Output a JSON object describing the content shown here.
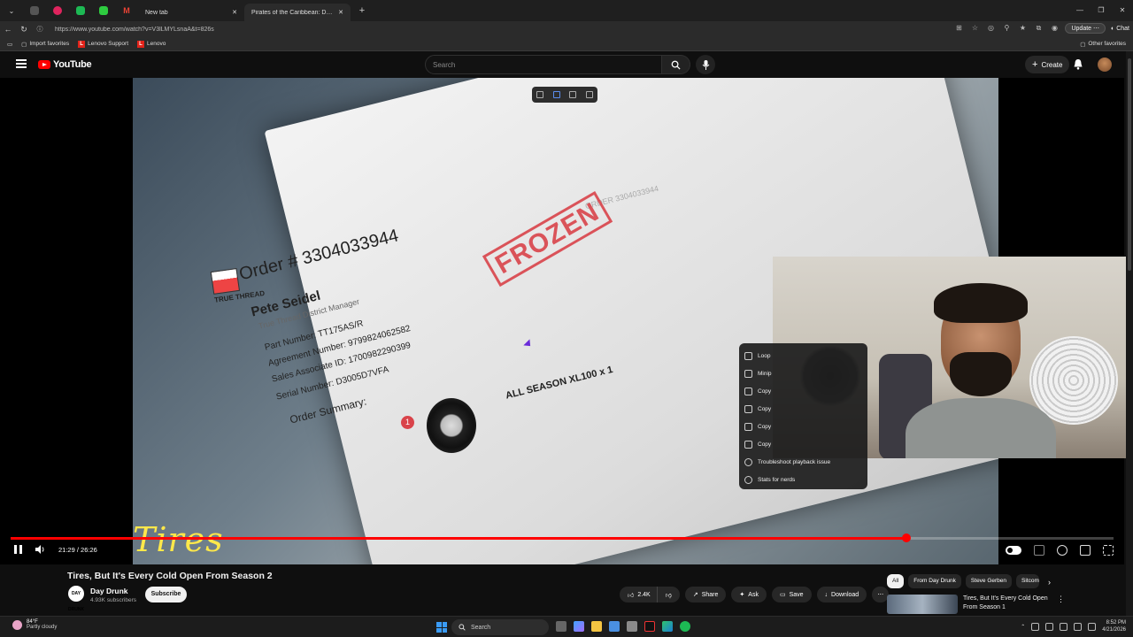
{
  "browser": {
    "tabs": [
      {
        "title": "New tab"
      },
      {
        "title": "Pirates of the Caribbean: Dead Ma"
      }
    ],
    "url": "https://www.youtube.com/watch?v=V3lLMYLsnaA&t=826s",
    "update_label": "Update",
    "chat_label": "Chat",
    "favorites": [
      "Import favorites",
      "Lenovo Support",
      "Lenovo"
    ],
    "other_favorites": "Other favorites"
  },
  "youtube": {
    "logo_text": "YouTube",
    "search_placeholder": "Search",
    "create_label": "Create"
  },
  "video": {
    "document": {
      "order_number": "Order # 3304033944",
      "name": "Pete Seidel",
      "name_title": "True Thread District Manager",
      "part_number": "Part Number: TT175AS/R",
      "agreement_number": "Agreement Number: 9799824062582",
      "sales_associate": "Sales Associate ID: 1700982290399",
      "serial_number": "Serial Number: D3005D7VFA",
      "order_summary": "Order Summary:",
      "product": "ALL SEASON XL100 x 1",
      "stamp": "FROZEN",
      "brand": "TRUE THREAD",
      "order_top": "ORDER 3304033944",
      "item_badge": "1"
    },
    "overlay_text": "Tires",
    "time_display": "21:29 / 26:26",
    "progress": 0.8126,
    "context_menu": [
      {
        "label": "Loop"
      },
      {
        "label": "Minip"
      },
      {
        "label": "Copy"
      },
      {
        "label": "Copy"
      },
      {
        "label": "Copy"
      },
      {
        "label": "Copy"
      },
      {
        "label": "Troubleshoot playback issue"
      },
      {
        "label": "Stats for nerds"
      }
    ]
  },
  "details": {
    "title": "Tires, But It's Every Cold Open From Season 2",
    "channel": "Day Drunk",
    "channel_avatar_text": "DAY DRUNK",
    "subscribers": "4.93K subscribers",
    "subscribe_label": "Subscribe",
    "like_count": "2.4K",
    "share_label": "Share",
    "ask_label": "Ask",
    "save_label": "Save",
    "download_label": "Download"
  },
  "sidebar": {
    "chips": [
      "All",
      "From Day Drunk",
      "Steve Gerben",
      "Sitcom"
    ],
    "recommendation": {
      "title": "Tires, But It's Every Cold Open From Season 1"
    }
  },
  "taskbar": {
    "weather_temp": "84°F",
    "weather_desc": "Partly cloudy",
    "search_label": "Search",
    "time": "8:52 PM",
    "date": "4/21/2026"
  },
  "colors": {
    "accent": "#ff0000",
    "stamp": "#d9434a",
    "overlay_text": "#ffe84a"
  }
}
